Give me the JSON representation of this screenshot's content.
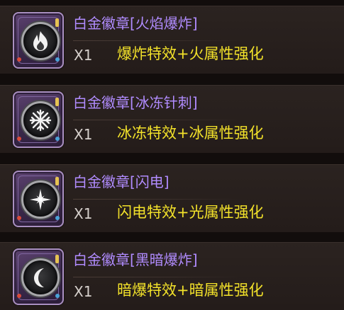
{
  "items": [
    {
      "title": "白金徽章[火焰爆炸]",
      "quantity": "X1",
      "effect": "爆炸特效+火属性强化",
      "icon": "flame-icon"
    },
    {
      "title": "白金徽章[冰冻针刺]",
      "quantity": "X1",
      "effect": "冰冻特效+冰属性强化",
      "icon": "snowflake-icon"
    },
    {
      "title": "白金徽章[闪电]",
      "quantity": "X1",
      "effect": "闪电特效+光属性强化",
      "icon": "star-burst-icon"
    },
    {
      "title": "白金徽章[黑暗爆炸]",
      "quantity": "X1",
      "effect": "暗爆特效+暗属性强化",
      "icon": "crescent-moon-icon"
    }
  ],
  "colors": {
    "title": "#b18cff",
    "effect": "#f3e22a",
    "quantity": "#d6d0cc",
    "background": "#120d0c"
  }
}
